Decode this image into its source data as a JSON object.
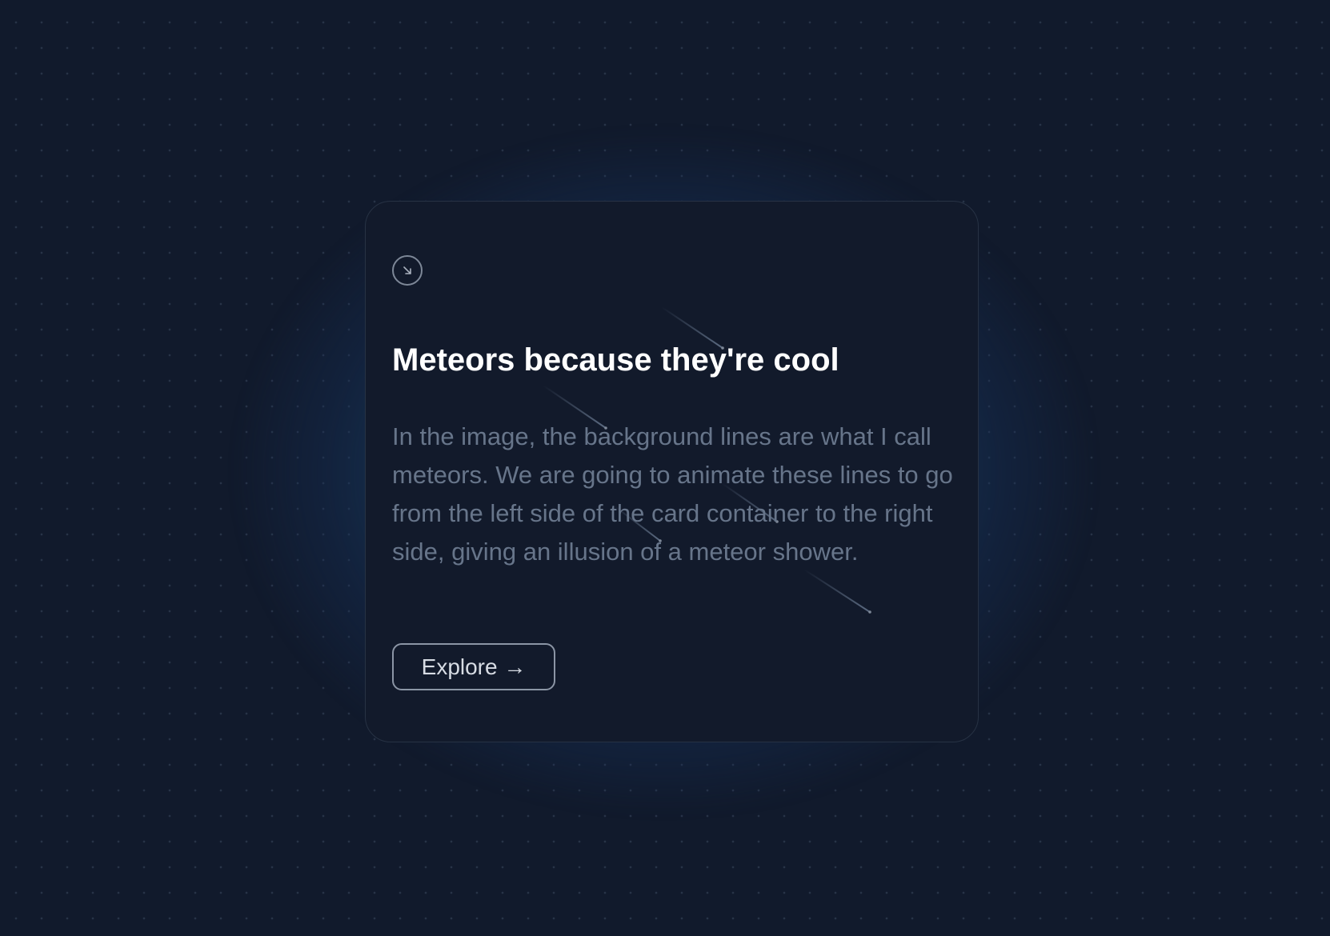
{
  "card": {
    "title": "Meteors because they're cool",
    "description": "In the image, the background lines are what I call meteors. We are going to animate these lines to go from the left side of the card container to the right side, giving an illusion of a meteor shower.",
    "button_label": "Explore →",
    "icon": "arrow-down-right-icon"
  },
  "colors": {
    "background": "#111a2c",
    "card_background": "#121a2b",
    "title": "#ffffff",
    "description": "#67758a",
    "glow": "#1c4e76"
  }
}
